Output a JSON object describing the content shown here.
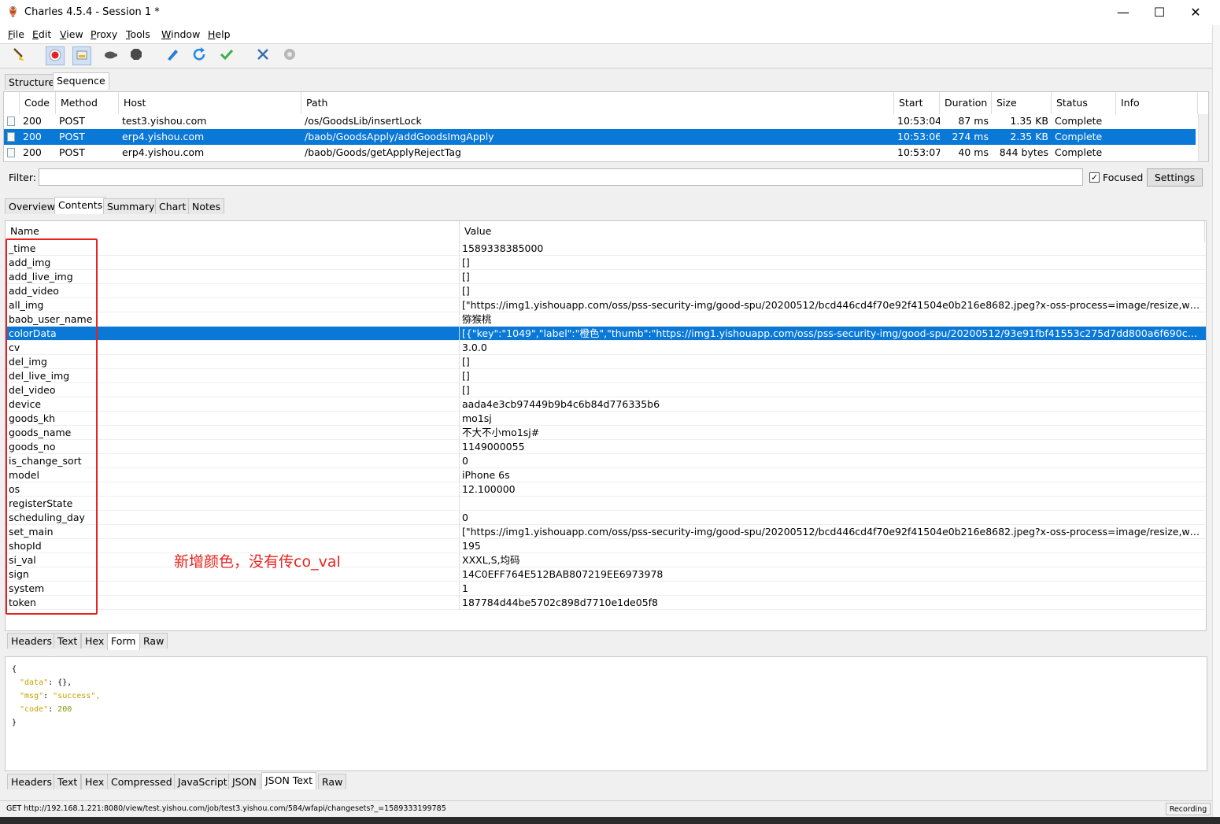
{
  "window": {
    "title": "Charles 4.5.4 - Session 1 *",
    "minimize": "—",
    "maximize": "☐",
    "close": "✕"
  },
  "menu": [
    "File",
    "Edit",
    "View",
    "Proxy",
    "Tools",
    "Window",
    "Help"
  ],
  "toolbar": {
    "icons": [
      "broom-icon",
      "record-icon",
      "throttle-icon",
      "turtle-icon",
      "stop-icon",
      "pen-icon",
      "refresh-icon",
      "check-icon",
      "tools-icon",
      "settings-icon"
    ]
  },
  "view_tabs": [
    "Structure",
    "Sequence"
  ],
  "sequence": {
    "columns": [
      "Code",
      "Method",
      "Host",
      "Path",
      "Start",
      "Duration",
      "Size",
      "Status",
      "Info"
    ],
    "rows": [
      {
        "code": "200",
        "method": "POST",
        "host": "test3.yishou.com",
        "path": "/os/GoodsLib/insertLock",
        "start": "10:53:04",
        "duration": "87 ms",
        "size": "1.35 KB",
        "status": "Complete",
        "info": ""
      },
      {
        "code": "200",
        "method": "POST",
        "host": "erp4.yishou.com",
        "path": "/baob/GoodsApply/addGoodsImgApply",
        "start": "10:53:06",
        "duration": "274 ms",
        "size": "2.35 KB",
        "status": "Complete",
        "info": ""
      },
      {
        "code": "200",
        "method": "POST",
        "host": "erp4.yishou.com",
        "path": "/baob/Goods/getApplyRejectTag",
        "start": "10:53:07",
        "duration": "40 ms",
        "size": "844 bytes",
        "status": "Complete",
        "info": ""
      }
    ]
  },
  "filter": {
    "label": "Filter:",
    "value": "",
    "focused_label": "Focused",
    "focused_checked": "✓",
    "settings_label": "Settings"
  },
  "detail_tabs": [
    "Overview",
    "Contents",
    "Summary",
    "Chart",
    "Notes"
  ],
  "form": {
    "columns": [
      "Name",
      "Value"
    ],
    "rows": [
      {
        "name": "_time",
        "value": "1589338385000"
      },
      {
        "name": "add_img",
        "value": "[]"
      },
      {
        "name": "add_live_img",
        "value": "[]"
      },
      {
        "name": "add_video",
        "value": "[]"
      },
      {
        "name": "all_img",
        "value": "[\"https://img1.yishouapp.com/oss/pss-security-img/good-spu/20200512/bcd446cd4f70e92f41504e0b216e8682.jpeg?x-oss-process=image/resize,w_600\"]"
      },
      {
        "name": "baob_user_name",
        "value": "猕猴桃"
      },
      {
        "name": "colorData",
        "value": "[{\"key\":\"1049\",\"label\":\"橙色\",\"thumb\":\"https://img1.yishouapp.com/oss/pss-security-img/good-spu/20200512/93e91fbf41553c275d7dd800a6f690c0.jpg?x-oss-pr..."
      },
      {
        "name": "cv",
        "value": "3.0.0"
      },
      {
        "name": "del_img",
        "value": "[]"
      },
      {
        "name": "del_live_img",
        "value": "[]"
      },
      {
        "name": "del_video",
        "value": "[]"
      },
      {
        "name": "device",
        "value": "aada4e3cb97449b9b4c6b84d776335b6"
      },
      {
        "name": "goods_kh",
        "value": "mo1sj"
      },
      {
        "name": "goods_name",
        "value": "不大不小mo1sj#"
      },
      {
        "name": "goods_no",
        "value": "1149000055"
      },
      {
        "name": "is_change_sort",
        "value": "0"
      },
      {
        "name": "model",
        "value": "iPhone 6s"
      },
      {
        "name": "os",
        "value": "12.100000"
      },
      {
        "name": "registerState",
        "value": ""
      },
      {
        "name": "scheduling_day",
        "value": "0"
      },
      {
        "name": "set_main",
        "value": "[\"https://img1.yishouapp.com/oss/pss-security-img/good-spu/20200512/bcd446cd4f70e92f41504e0b216e8682.jpeg?x-oss-process=image/resize,w_600\"]"
      },
      {
        "name": "shopId",
        "value": "195"
      },
      {
        "name": "si_val",
        "value": "XXXL,S,均码"
      },
      {
        "name": "sign",
        "value": "14C0EFF764E512BAB807219EE6973978"
      },
      {
        "name": "system",
        "value": "1"
      },
      {
        "name": "token",
        "value": "187784d44be5702c898d7710e1de05f8"
      }
    ]
  },
  "annotation": "新增颜色，没有传co_val",
  "request_tabs": [
    "Headers",
    "Text",
    "Hex",
    "Form",
    "Raw"
  ],
  "response_json": {
    "open": "{",
    "data_key": "\"data\"",
    "data_val": "{},",
    "msg_key": "\"msg\"",
    "msg_val": "\"success\",",
    "code_key": "\"code\"",
    "code_val": "200",
    "close": "}"
  },
  "response_tabs": [
    "Headers",
    "Text",
    "Hex",
    "Compressed",
    "JavaScript",
    "JSON",
    "JSON Text",
    "Raw"
  ],
  "status": {
    "text": "GET http://192.168.1.221:8080/view/test.yishou.com/job/test3.yishou.com/584/wfapi/changesets?_=1589333199785",
    "recording": "Recording"
  },
  "colors": {
    "selection": "#0a78d7",
    "annotation": "#e8231f"
  }
}
